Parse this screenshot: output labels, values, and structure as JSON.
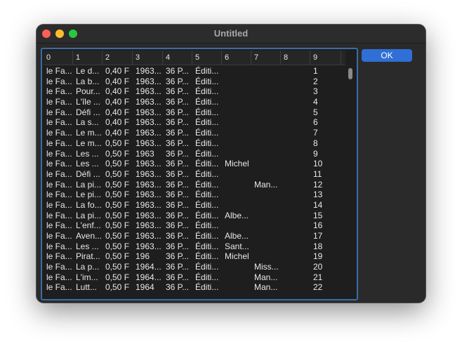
{
  "window": {
    "title": "Untitled"
  },
  "buttons": {
    "ok": "OK"
  },
  "table": {
    "columns": [
      "0",
      "1",
      "2",
      "3",
      "4",
      "5",
      "6",
      "7",
      "8",
      "9"
    ],
    "rows": [
      [
        "le Fa...",
        "Le d...",
        "0,40 F",
        "1963...",
        "36 P...",
        "Éditi...",
        "",
        "",
        "",
        "1"
      ],
      [
        "le Fa...",
        "La b...",
        "0,40 F",
        "1963...",
        "36 P...",
        "Éditi...",
        "",
        "",
        "",
        "2"
      ],
      [
        "le Fa...",
        "Pour...",
        "0,40 F",
        "1963...",
        "36 P...",
        "Éditi...",
        "",
        "",
        "",
        "3"
      ],
      [
        "le Fa...",
        "L'île ...",
        "0,40 F",
        "1963...",
        "36 P...",
        "Éditi...",
        "",
        "",
        "",
        "4"
      ],
      [
        "le Fa...",
        "Défi ...",
        "0,40 F",
        "1963...",
        "36 P...",
        "Éditi...",
        "",
        "",
        "",
        "5"
      ],
      [
        "le Fa...",
        "La s...",
        "0,40 F",
        "1963...",
        "36 P...",
        "Éditi...",
        "",
        "",
        "",
        "6"
      ],
      [
        "le Fa...",
        "Le m...",
        "0,40 F",
        "1963...",
        "36 P...",
        "Éditi...",
        "",
        "",
        "",
        "7"
      ],
      [
        "le Fa...",
        "Le m...",
        "0,50 F",
        "1963...",
        "36 P...",
        "Éditi...",
        "",
        "",
        "",
        "8"
      ],
      [
        "le Fa...",
        "Les ...",
        "0,50 F",
        "1963",
        "36 P...",
        "Éditi...",
        "",
        "",
        "",
        "9"
      ],
      [
        "le Fa...",
        "Les ...",
        "0,50 F",
        "1963...",
        "36 P...",
        "Éditi...",
        "Michel",
        "",
        "",
        "10"
      ],
      [
        "le Fa...",
        "Défi ...",
        "0,50 F",
        "1963...",
        "36 P...",
        "Éditi...",
        "",
        "",
        "",
        "11"
      ],
      [
        "le Fa...",
        "La pi...",
        "0,50 F",
        "1963...",
        "36 P...",
        "Éditi...",
        "",
        "Man...",
        "",
        "12"
      ],
      [
        "le Fa...",
        "Le pi...",
        "0,50 F",
        "1963...",
        "36 P...",
        "Éditi...",
        "",
        "",
        "",
        "13"
      ],
      [
        "le Fa...",
        "La fo...",
        "0,50 F",
        "1963...",
        "36 P...",
        "Éditi...",
        "",
        "",
        "",
        "14"
      ],
      [
        "le Fa...",
        "La pi...",
        "0,50 F",
        "1963...",
        "36 P...",
        "Éditi...",
        "Albe...",
        "",
        "",
        "15"
      ],
      [
        "le Fa...",
        "L'enf...",
        "0,50 F",
        "1963...",
        "36 P...",
        "Éditi...",
        "",
        "",
        "",
        "16"
      ],
      [
        "le Fa...",
        "Aven...",
        "0,50 F",
        "1963...",
        "36 P...",
        "Éditi...",
        "Albe...",
        "",
        "",
        "17"
      ],
      [
        "le Fa...",
        "Les ...",
        "0,50 F",
        "1963...",
        "36 P...",
        "Éditi...",
        "Sant...",
        "",
        "",
        "18"
      ],
      [
        "le Fa...",
        "Pirat...",
        "0,50 F",
        "196",
        "36 P...",
        "Éditi...",
        "Michel",
        "",
        "",
        "19"
      ],
      [
        "le Fa...",
        "La p...",
        "0,50 F",
        "1964...",
        "36 P...",
        "Éditi...",
        "",
        "Miss...",
        "",
        "20"
      ],
      [
        "le Fa...",
        "L'im...",
        "0,50 F",
        "1964...",
        "36 P...",
        "Éditi...",
        "",
        "Man...",
        "",
        "21"
      ],
      [
        "le Fa...",
        "Lutt...",
        "0,50 F",
        "1964",
        "36 P...",
        "Éditi...",
        "",
        "Man...",
        "",
        "22"
      ]
    ]
  }
}
